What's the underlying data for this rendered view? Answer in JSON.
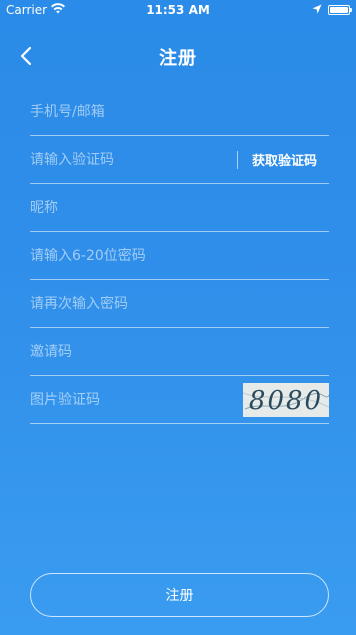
{
  "status_bar": {
    "carrier": "Carrier",
    "time": "11:53 AM",
    "battery_level": 1.0
  },
  "nav": {
    "title": "注册"
  },
  "form": {
    "account_placeholder": "手机号/邮箱",
    "verify_code_placeholder": "请输入验证码",
    "get_code_label": "获取验证码",
    "nickname_placeholder": "昵称",
    "password_placeholder": "请输入6-20位密码",
    "confirm_password_placeholder": "请再次输入密码",
    "invite_code_placeholder": "邀请码",
    "captcha_placeholder": "图片验证码",
    "captcha_text": "8080"
  },
  "submit": {
    "label": "注册"
  }
}
